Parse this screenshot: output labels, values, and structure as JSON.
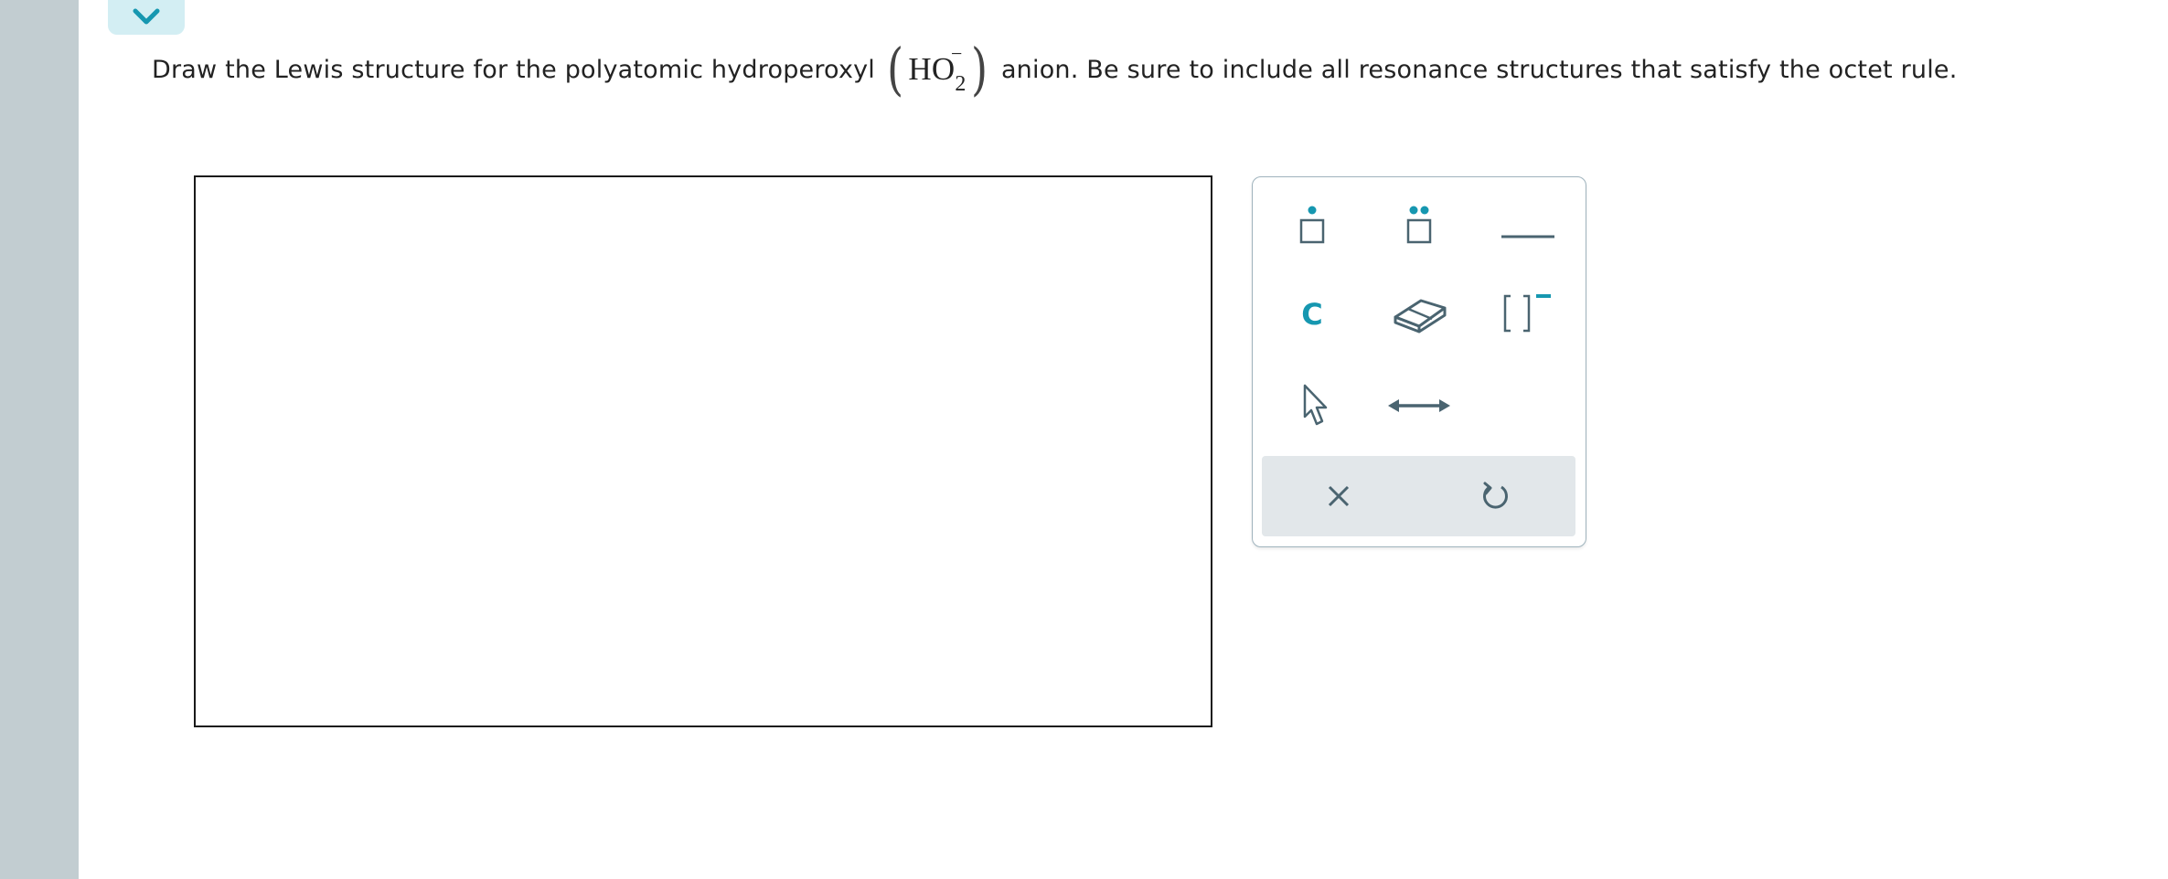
{
  "colors": {
    "accent": "#1697b0",
    "icon_slate": "#4a6470",
    "rail": "#c2cdd1",
    "tab_bg": "#d3eef3",
    "footer_bg": "#e2e7ea"
  },
  "header": {
    "collapse_icon": "chevron-down-icon"
  },
  "question": {
    "text_before": "Draw the Lewis structure for the polyatomic hydroperoxyl",
    "formula_main": "HO",
    "formula_subscript": "2",
    "formula_charge": "−",
    "text_after": "anion. Be sure to include all resonance structures that satisfy the octet rule."
  },
  "palette": {
    "tools": [
      {
        "id": "single-dot",
        "icon": "single-electron-dot-icon"
      },
      {
        "id": "lone-pair",
        "icon": "lone-pair-dots-icon"
      },
      {
        "id": "bond",
        "icon": "single-bond-icon"
      },
      {
        "id": "atom",
        "icon": "carbon-atom-icon",
        "label": "C"
      },
      {
        "id": "eraser",
        "icon": "eraser-icon"
      },
      {
        "id": "bracket",
        "icon": "bracket-charge-icon"
      },
      {
        "id": "select",
        "icon": "cursor-arrow-icon"
      },
      {
        "id": "resonance",
        "icon": "resonance-arrow-icon"
      }
    ],
    "footer": [
      {
        "id": "clear",
        "icon": "close-icon"
      },
      {
        "id": "undo",
        "icon": "undo-icon"
      }
    ]
  }
}
